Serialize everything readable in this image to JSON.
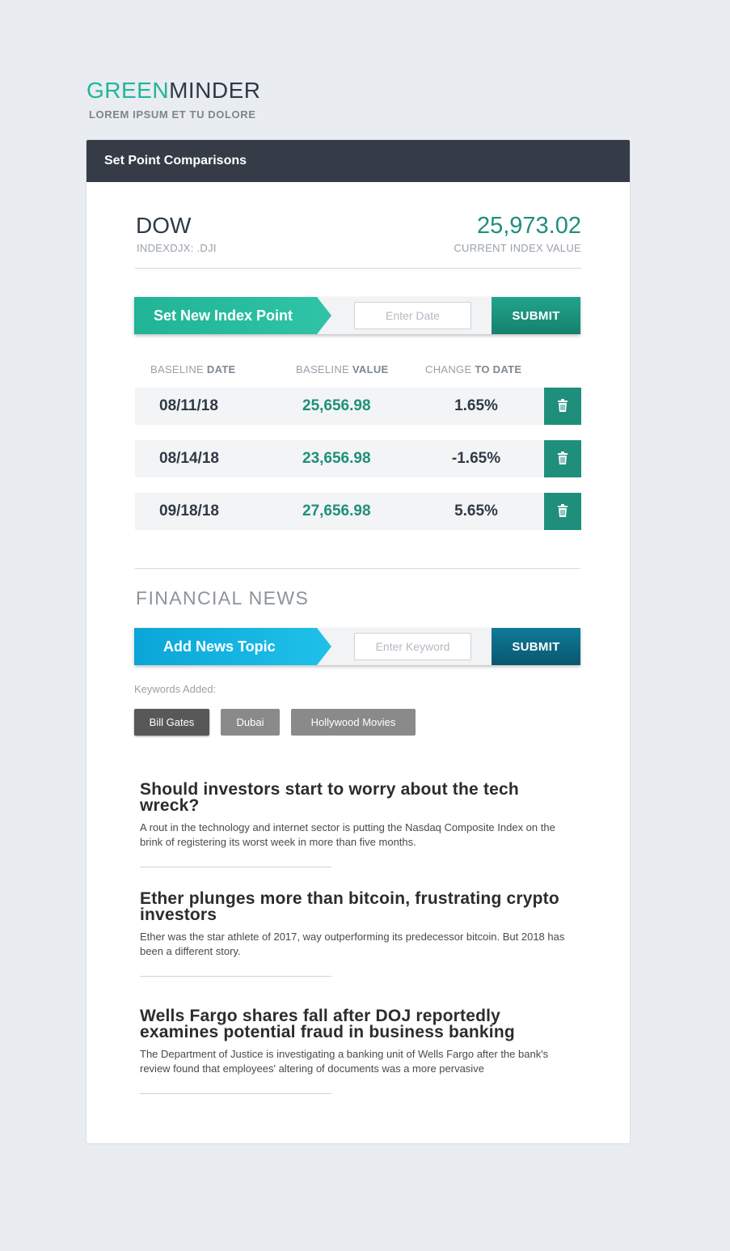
{
  "brand": {
    "logo_part1": "GREEN",
    "logo_part2": "MINDER",
    "tagline": "LOREM IPSUM ET TU DOLORE"
  },
  "card": {
    "title": "Set Point Comparisons"
  },
  "index": {
    "name": "DOW",
    "code": "INDEXDJX: .DJI",
    "value": "25,973.02",
    "value_label": "CURRENT INDEX VALUE"
  },
  "index_point": {
    "tag_label": "Set New Index Point",
    "input_placeholder": "Enter Date",
    "submit_label": "SUBMIT"
  },
  "table": {
    "headers": [
      {
        "light": "BASELINE ",
        "bold": "DATE"
      },
      {
        "light": "BASELINE ",
        "bold": "VALUE"
      },
      {
        "light": "CHANGE ",
        "bold": "TO DATE"
      }
    ],
    "rows": [
      {
        "date": "08/11/18",
        "value": "25,656.98",
        "change": "1.65%"
      },
      {
        "date": "08/14/18",
        "value": "23,656.98",
        "change": "-1.65%"
      },
      {
        "date": "09/18/18",
        "value": "27,656.98",
        "change": "5.65%"
      }
    ]
  },
  "news": {
    "section_title": "FINANCIAL NEWS",
    "tag_label": "Add News Topic",
    "input_placeholder": "Enter Keyword",
    "submit_label": "SUBMIT",
    "keywords_label": "Keywords Added:",
    "keywords": [
      "Bill Gates",
      "Dubai",
      "Hollywood Movies"
    ],
    "articles": [
      {
        "title": "Should investors start to worry about the tech wreck?",
        "body": "A rout in the technology and internet sector is putting the Nasdaq Composite Index on the brink of registering its worst week in more than five months."
      },
      {
        "title": "Ether plunges more than bitcoin, frustrating crypto investors",
        "body": "Ether was the star athlete of 2017, way outperforming its predecessor bitcoin. But 2018 has been a different story."
      },
      {
        "title": "Wells Fargo shares fall after DOJ reportedly examines potential fraud in business banking",
        "body": "The Department of Justice is investigating a banking unit of Wells Fargo after the bank's review found that employees' altering of documents was a more pervasive"
      }
    ]
  },
  "colors": {
    "brand_green": "#20b59a",
    "header_dark": "#353c47",
    "value_teal": "#1f8f7c",
    "news_blue": "#0aa6d8"
  },
  "icons": {
    "delete": "trash-icon"
  }
}
